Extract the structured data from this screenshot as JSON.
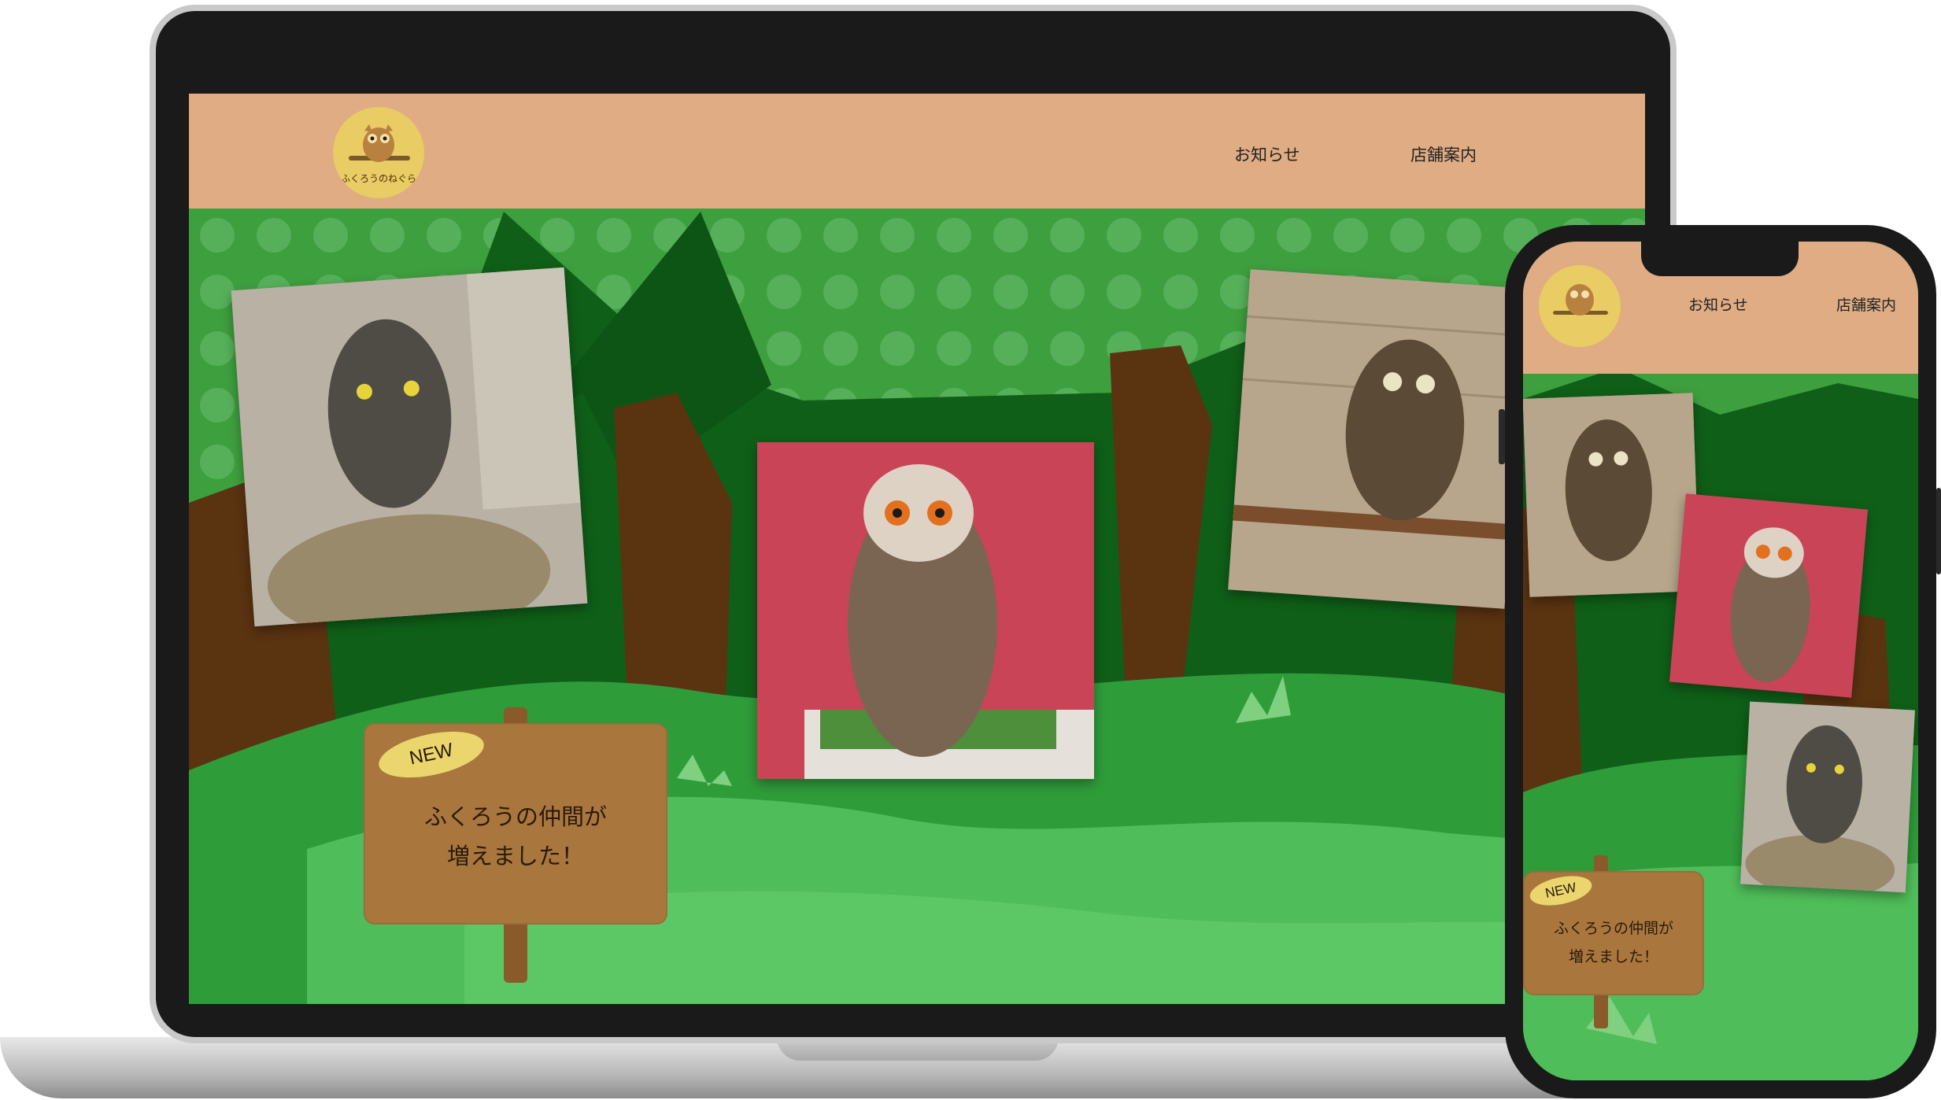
{
  "site": {
    "logo_text": "ふくろうのねぐら",
    "nav": [
      {
        "label": "お知らせ"
      },
      {
        "label": "店舗案内"
      }
    ],
    "sign": {
      "badge": "NEW",
      "line1": "ふくろうの仲間が",
      "line2": "増えました！"
    },
    "photos": [
      {
        "alt": "grey owl on stump"
      },
      {
        "alt": "white-faced owl on perch"
      },
      {
        "alt": "little owl on branch"
      }
    ]
  },
  "colors": {
    "header": "#dfac84",
    "canopy": "#3e9f3f",
    "dark_green": "#0e5d17",
    "grass": "#4fbd59",
    "trunk": "#5a3311",
    "sign": "#a9773e",
    "badge": "#ebd56d",
    "logo": "#e9cc63"
  }
}
